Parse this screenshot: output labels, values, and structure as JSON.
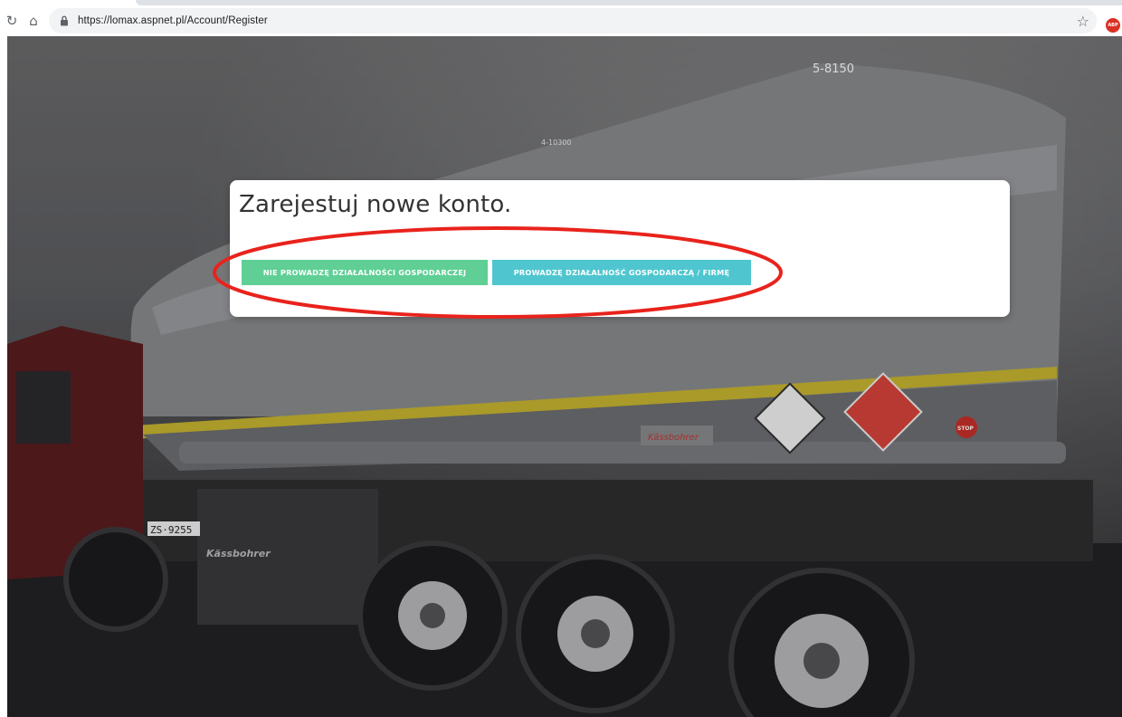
{
  "browser": {
    "url": "https://lomax.aspnet.pl/Account/Register",
    "icons": [
      "reload-icon",
      "home-icon",
      "lock-icon",
      "star-icon",
      "extension-icon"
    ]
  },
  "register": {
    "title": "Zarejestuj nowe konto.",
    "private_button_label": "NIE PROWADZĘ DZIAŁALNOŚCI GOSPODARCZEJ",
    "business_button_label": "PROWADZĘ DZIAŁALNOŚĆ GOSPODARCZĄ / FIRMĘ"
  },
  "background": {
    "tank_labels": [
      "5-8150",
      "4-10300"
    ],
    "plate_text": "ZS·9255",
    "brand_text": "Kässbohrer",
    "stop_text": "STOP"
  },
  "colors": {
    "private_button": "#5fcf95",
    "business_button": "#4fc6cf",
    "annotation": "#e8231c"
  }
}
